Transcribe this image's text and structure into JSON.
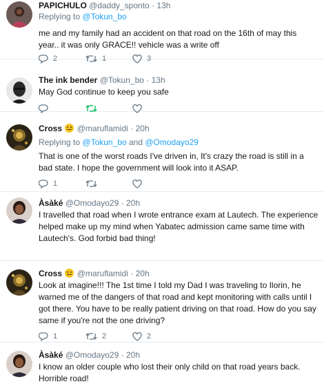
{
  "tweets": [
    {
      "display_name": "PAPICHULO",
      "handle": "@daddy_sponto",
      "time": "13h",
      "replying_prefix": "Replying to",
      "replying_to": "@Tokun_bo",
      "replying_to_2": "",
      "text": "me and my family had an accident on that road on the 16th of may this year.. it was only GRACE!! vehicle was a write off",
      "replies": "2",
      "retweets": "1",
      "likes": "3",
      "emoji": false
    },
    {
      "display_name": "The ink bender",
      "handle": "@Tokun_bo",
      "time": "13h",
      "text": "May God continue to keep you safe",
      "replies": "",
      "retweets": "",
      "likes": "",
      "emoji": false
    },
    {
      "display_name": "Cross",
      "handle": "@maruflamidi",
      "time": "20h",
      "replying_prefix": "Replying to",
      "replying_to": "@Tokun_bo",
      "replying_to_2": "@Omodayo29",
      "text": "That is one of the worst roads I've driven in, It's crazy the road is still in a bad state. I hope the government will look into it ASAP.",
      "replies": "1",
      "retweets": "",
      "likes": "",
      "emoji": true
    },
    {
      "display_name": "Àsàké",
      "handle": "@Omodayo29",
      "time": "20h",
      "text": "I travelled that road when I wrote entrance exam at Lautech. The experience helped make up my mind when Yabatec admission came same time with Lautech's. God forbid bad thing!",
      "replies": "",
      "retweets": "",
      "likes": "",
      "emoji": false
    },
    {
      "display_name": "Cross",
      "handle": "@maruflamidi",
      "time": "20h",
      "text": "Look at imagine!!! The 1st time I told my Dad I was traveling to Ilorin, he warned me of the dangers of that road and kept monitoring with calls until I got there. You have to be really patient driving on that road. How do you say same if you're not the one driving?",
      "replies": "1",
      "retweets": "2",
      "likes": "2",
      "emoji": true
    },
    {
      "display_name": "Àsàké",
      "handle": "@Omodayo29",
      "time": "20h",
      "text": "I know an older couple who lost their only child on that road years back. Horrible road!",
      "emoji": false
    }
  ],
  "separator": "·",
  "and_word": "and",
  "icons": {
    "reply": "reply-icon",
    "retweet": "retweet-icon",
    "like": "heart-icon"
  },
  "colors": {
    "link": "#1da1f2",
    "muted": "#657786",
    "retweeted": "#17bf63"
  }
}
